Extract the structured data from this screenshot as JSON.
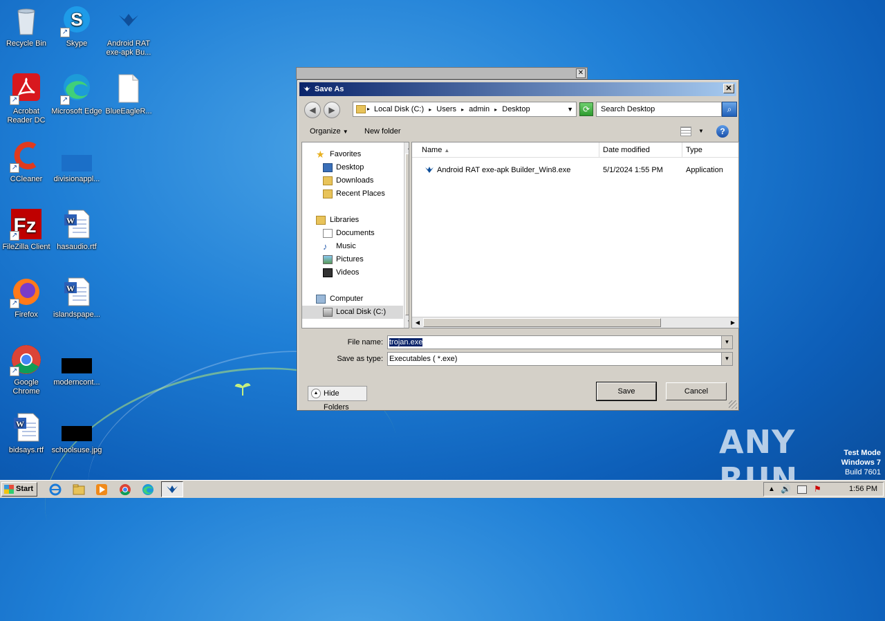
{
  "desktop": {
    "icons": [
      {
        "label": "Recycle Bin"
      },
      {
        "label": "Skype"
      },
      {
        "label": "Android RAT exe-apk Bu..."
      },
      {
        "label": "Acrobat Reader DC"
      },
      {
        "label": "Microsoft Edge"
      },
      {
        "label": "BlueEagleR..."
      },
      {
        "label": "CCleaner"
      },
      {
        "label": "divisionappl..."
      },
      {
        "label": "FileZilla Client"
      },
      {
        "label": "hasaudio.rtf"
      },
      {
        "label": "Firefox"
      },
      {
        "label": "islandspape..."
      },
      {
        "label": "Google Chrome"
      },
      {
        "label": "moderncont..."
      },
      {
        "label": "bidsays.rtf"
      },
      {
        "label": "schoolsuse.jpg"
      }
    ],
    "watermark": "ANY RUN",
    "test_mode": {
      "line1": "Test Mode",
      "line2": "Windows 7",
      "line3": "Build 7601"
    }
  },
  "dialog": {
    "title": "Save As",
    "close_label": "✕",
    "address": {
      "crumbs": [
        "Local Disk (C:)",
        "Users",
        "admin",
        "Desktop"
      ]
    },
    "search_placeholder": "Search Desktop",
    "toolbar": {
      "organize": "Organize",
      "new_folder": "New folder"
    },
    "nav": {
      "favorites": "Favorites",
      "desktop": "Desktop",
      "downloads": "Downloads",
      "recent": "Recent Places",
      "libraries": "Libraries",
      "documents": "Documents",
      "music": "Music",
      "pictures": "Pictures",
      "videos": "Videos",
      "computer": "Computer",
      "local_disk": "Local Disk (C:)"
    },
    "columns": {
      "name": "Name",
      "date": "Date modified",
      "type": "Type"
    },
    "files": [
      {
        "name": "Android RAT exe-apk Builder_Win8.exe",
        "date": "5/1/2024 1:55 PM",
        "type": "Application"
      }
    ],
    "file_name_label": "File name:",
    "file_name_value": "trojan.exe",
    "save_type_label": "Save as type:",
    "save_type_value": "Executables  ( *.exe)",
    "hide_folders": "Hide Folders",
    "save_button": "Save",
    "cancel_button": "Cancel"
  },
  "taskbar": {
    "start": "Start",
    "clock": "1:56 PM"
  }
}
